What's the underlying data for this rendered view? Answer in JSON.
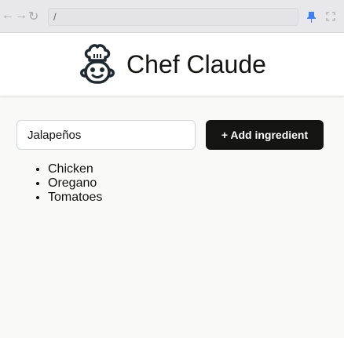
{
  "browser": {
    "url": "/",
    "back_icon": "arrow-left-icon",
    "forward_icon": "arrow-right-icon",
    "reload_icon": "reload-icon",
    "pin_icon": "pin-icon",
    "fullscreen_icon": "fullscreen-icon",
    "pin_color": "#3b82f6"
  },
  "header": {
    "title": "Chef Claude",
    "logo_icon": "chef-robot-icon"
  },
  "form": {
    "input_value": "Jalapeños",
    "button_label": "+  Add ingredient"
  },
  "ingredients": [
    "Chicken",
    "Oregano",
    "Tomatoes"
  ]
}
